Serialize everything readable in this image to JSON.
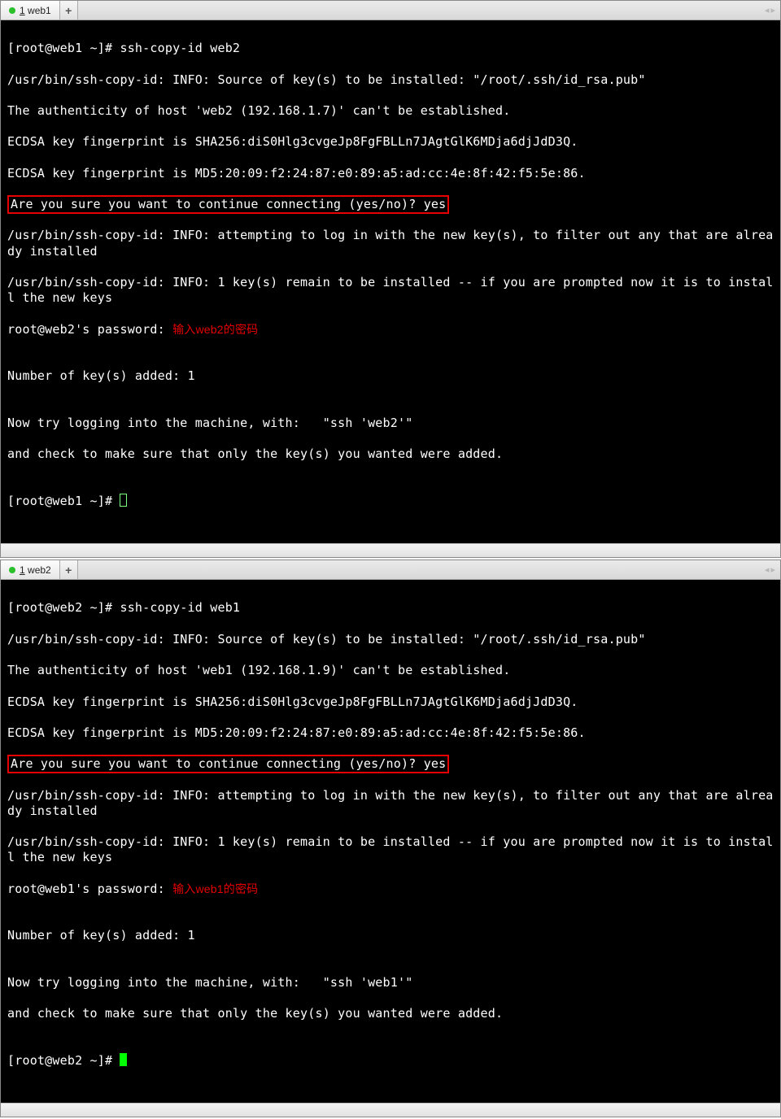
{
  "pane1": {
    "tab": {
      "index": "1",
      "name": "web1",
      "plus": "+",
      "arrows_left": "◂",
      "arrows_right": "▸"
    },
    "l01": "[root@web1 ~]# ssh-copy-id web2",
    "l02": "/usr/bin/ssh-copy-id: INFO: Source of key(s) to be installed: \"/root/.ssh/id_rsa.pub\"",
    "l03": "The authenticity of host 'web2 (192.168.1.7)' can't be established.",
    "l04": "ECDSA key fingerprint is SHA256:diS0Hlg3cvgeJp8FgFBLLn7JAgtGlK6MDja6djJdD3Q.",
    "l05": "ECDSA key fingerprint is MD5:20:09:f2:24:87:e0:89:a5:ad:cc:4e:8f:42:f5:5e:86.",
    "l06": "Are you sure you want to continue connecting (yes/no)? yes",
    "l07": "/usr/bin/ssh-copy-id: INFO: attempting to log in with the new key(s), to filter out any that are already installed",
    "l08": "/usr/bin/ssh-copy-id: INFO: 1 key(s) remain to be installed -- if you are prompted now it is to install the new keys",
    "l09a": "root@web2's password: ",
    "l09b": "输入web2的密码",
    "l10": "",
    "l11": "Number of key(s) added: 1",
    "l12": "",
    "l13": "Now try logging into the machine, with:   \"ssh 'web2'\"",
    "l14": "and check to make sure that only the key(s) you wanted were added.",
    "l15": "",
    "l16": "[root@web1 ~]# "
  },
  "pane2": {
    "tab": {
      "index": "1",
      "name": "web2",
      "plus": "+",
      "arrows_left": "◂",
      "arrows_right": "▸"
    },
    "l01": "[root@web2 ~]# ssh-copy-id web1",
    "l02": "/usr/bin/ssh-copy-id: INFO: Source of key(s) to be installed: \"/root/.ssh/id_rsa.pub\"",
    "l03": "The authenticity of host 'web1 (192.168.1.9)' can't be established.",
    "l04": "ECDSA key fingerprint is SHA256:diS0Hlg3cvgeJp8FgFBLLn7JAgtGlK6MDja6djJdD3Q.",
    "l05": "ECDSA key fingerprint is MD5:20:09:f2:24:87:e0:89:a5:ad:cc:4e:8f:42:f5:5e:86.",
    "l06": "Are you sure you want to continue connecting (yes/no)? yes",
    "l07": "/usr/bin/ssh-copy-id: INFO: attempting to log in with the new key(s), to filter out any that are already installed",
    "l08": "/usr/bin/ssh-copy-id: INFO: 1 key(s) remain to be installed -- if you are prompted now it is to install the new keys",
    "l09a": "root@web1's password: ",
    "l09b": "输入web1的密码",
    "l10": "",
    "l11": "Number of key(s) added: 1",
    "l12": "",
    "l13": "Now try logging into the machine, with:   \"ssh 'web1'\"",
    "l14": "and check to make sure that only the key(s) you wanted were added.",
    "l15": "",
    "l16": "[root@web2 ~]# "
  }
}
